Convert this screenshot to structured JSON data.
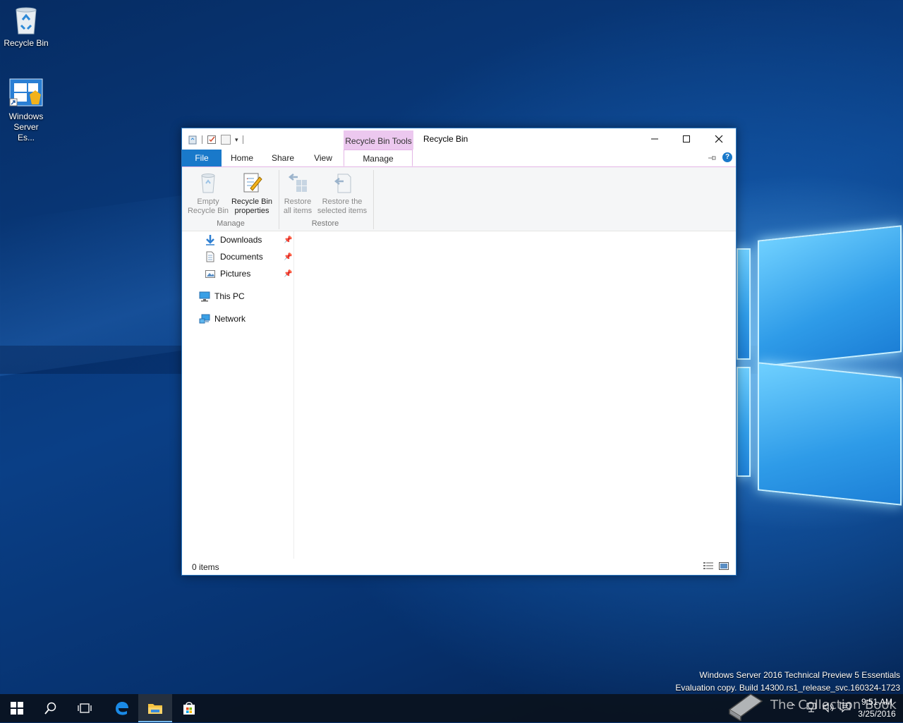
{
  "desktop": {
    "icons": [
      {
        "label": "Recycle Bin"
      },
      {
        "label": "Windows Server Es..."
      }
    ],
    "watermark": {
      "line1": "Windows Server 2016 Technical Preview 5 Essentials",
      "line2": "Evaluation copy. Build 14300.rs1_release_svc.160324-1723"
    },
    "brand_text": "The Collection Book"
  },
  "window": {
    "title": "Recycle Bin",
    "contextual_tab_group": "Recycle Bin Tools",
    "tabs": [
      {
        "label": "File"
      },
      {
        "label": "Home"
      },
      {
        "label": "Share"
      },
      {
        "label": "View"
      },
      {
        "label": "Manage"
      }
    ],
    "ribbon": {
      "groups": [
        {
          "label": "Manage",
          "buttons": [
            {
              "line1": "Empty",
              "line2": "Recycle Bin",
              "icon": "empty-recycle-bin-icon"
            },
            {
              "line1": "Recycle Bin",
              "line2": "properties",
              "icon": "properties-icon"
            }
          ]
        },
        {
          "label": "Restore",
          "buttons": [
            {
              "line1": "Restore",
              "line2": "all items",
              "icon": "restore-all-icon"
            },
            {
              "line1": "Restore the",
              "line2": "selected items",
              "icon": "restore-selected-icon"
            }
          ]
        }
      ]
    },
    "nav": {
      "quick_access": [
        {
          "label": "Downloads",
          "icon": "downloads-icon",
          "pinned": true
        },
        {
          "label": "Documents",
          "icon": "documents-icon",
          "pinned": true
        },
        {
          "label": "Pictures",
          "icon": "pictures-icon",
          "pinned": true
        }
      ],
      "this_pc": "This PC",
      "network": "Network"
    },
    "status": "0 items"
  },
  "taskbar": {
    "time": "9:51 AM",
    "date": "3/25/2016",
    "apps": [
      "start-icon",
      "search-icon",
      "task-view-icon",
      "edge-icon",
      "file-explorer-icon",
      "store-icon"
    ]
  },
  "colors": {
    "file_tab": "#1979ca",
    "contextual_tab": "#ecc8ef",
    "taskbar_accent": "#76b9ed"
  }
}
